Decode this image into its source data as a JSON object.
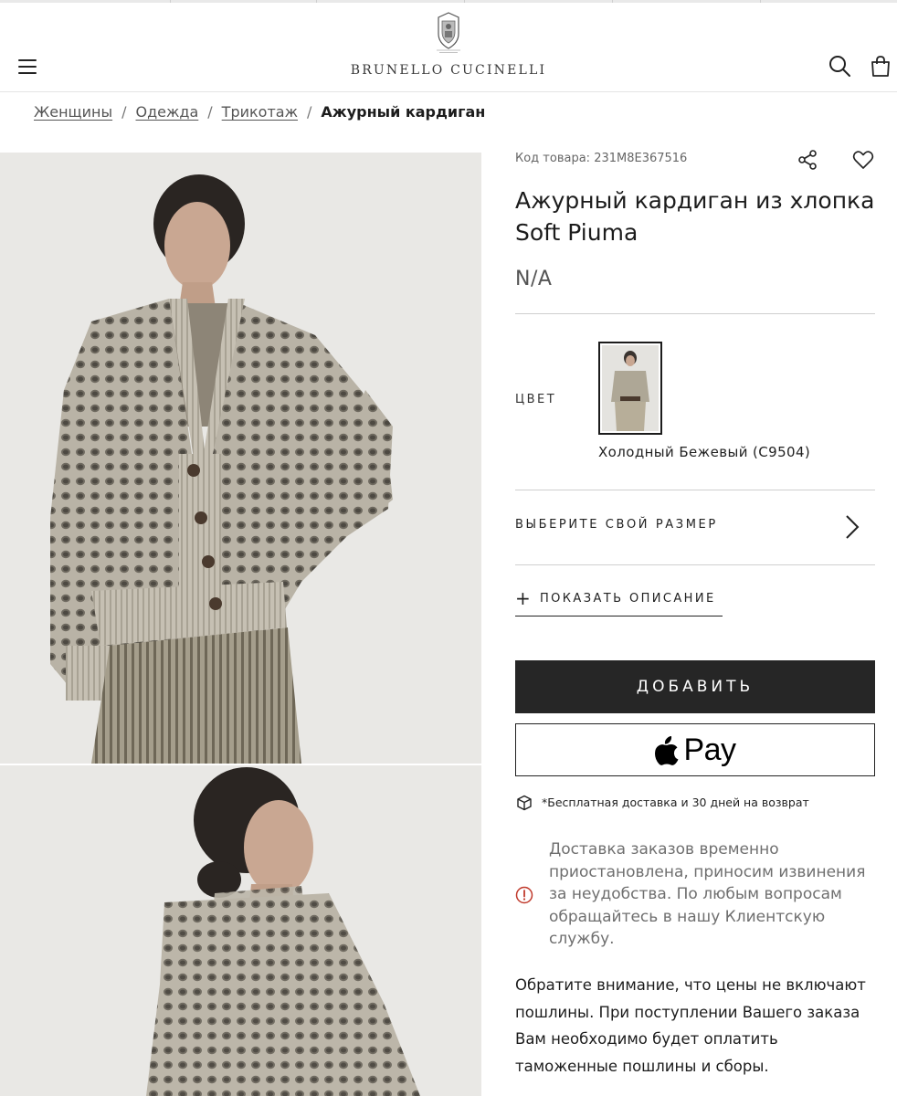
{
  "header": {
    "brand": "BRUNELLO CUCINELLI",
    "menu_icon": "hamburger-menu-icon",
    "search_icon": "search-icon",
    "bag_icon": "shopping-bag-icon"
  },
  "breadcrumb": {
    "items": [
      "Женщины",
      "Одежда",
      "Трикотаж"
    ],
    "separator": "/",
    "current": "Ажурный кардиган"
  },
  "product": {
    "sku_label": "Код товара: 231M8E367516",
    "share_icon": "share-icon",
    "favorite_icon": "heart-icon",
    "title": "Ажурный кардиган из хлопка Soft Piuma",
    "price": "N/A",
    "color_label": "ЦВЕТ",
    "color_name": "Холодный Бежевый (C9504)",
    "size_label": "ВЫБЕРИТЕ СВОЙ РАЗМЕР",
    "size_icon": "chevron-right-icon",
    "description_plus": "+",
    "description_label": "ПОКАЗАТЬ ОПИСАНИЕ",
    "add_button": "ДОБАВИТЬ",
    "pay_button": "Pay",
    "pay_icon": "apple-logo-icon",
    "shipping_icon": "package-icon",
    "shipping_note": "*Бесплатная доставка и 30 дней на возврат",
    "warning_icon": "alert-circle-icon",
    "warning_text": "Доставка заказов временно приостановлена, приносим извинения за неудобства. По любым вопросам обращайтесь в нашу Клиентскую службу.",
    "customs_note": "Обратите внимание, что цены не включают пошлины. При поступлении Вашего заказа Вам необходимо будет оплатить таможенные пошлины и сборы."
  },
  "colors": {
    "accent": "#262626",
    "warning": "#c0392b",
    "muted": "#6f6f6f"
  }
}
